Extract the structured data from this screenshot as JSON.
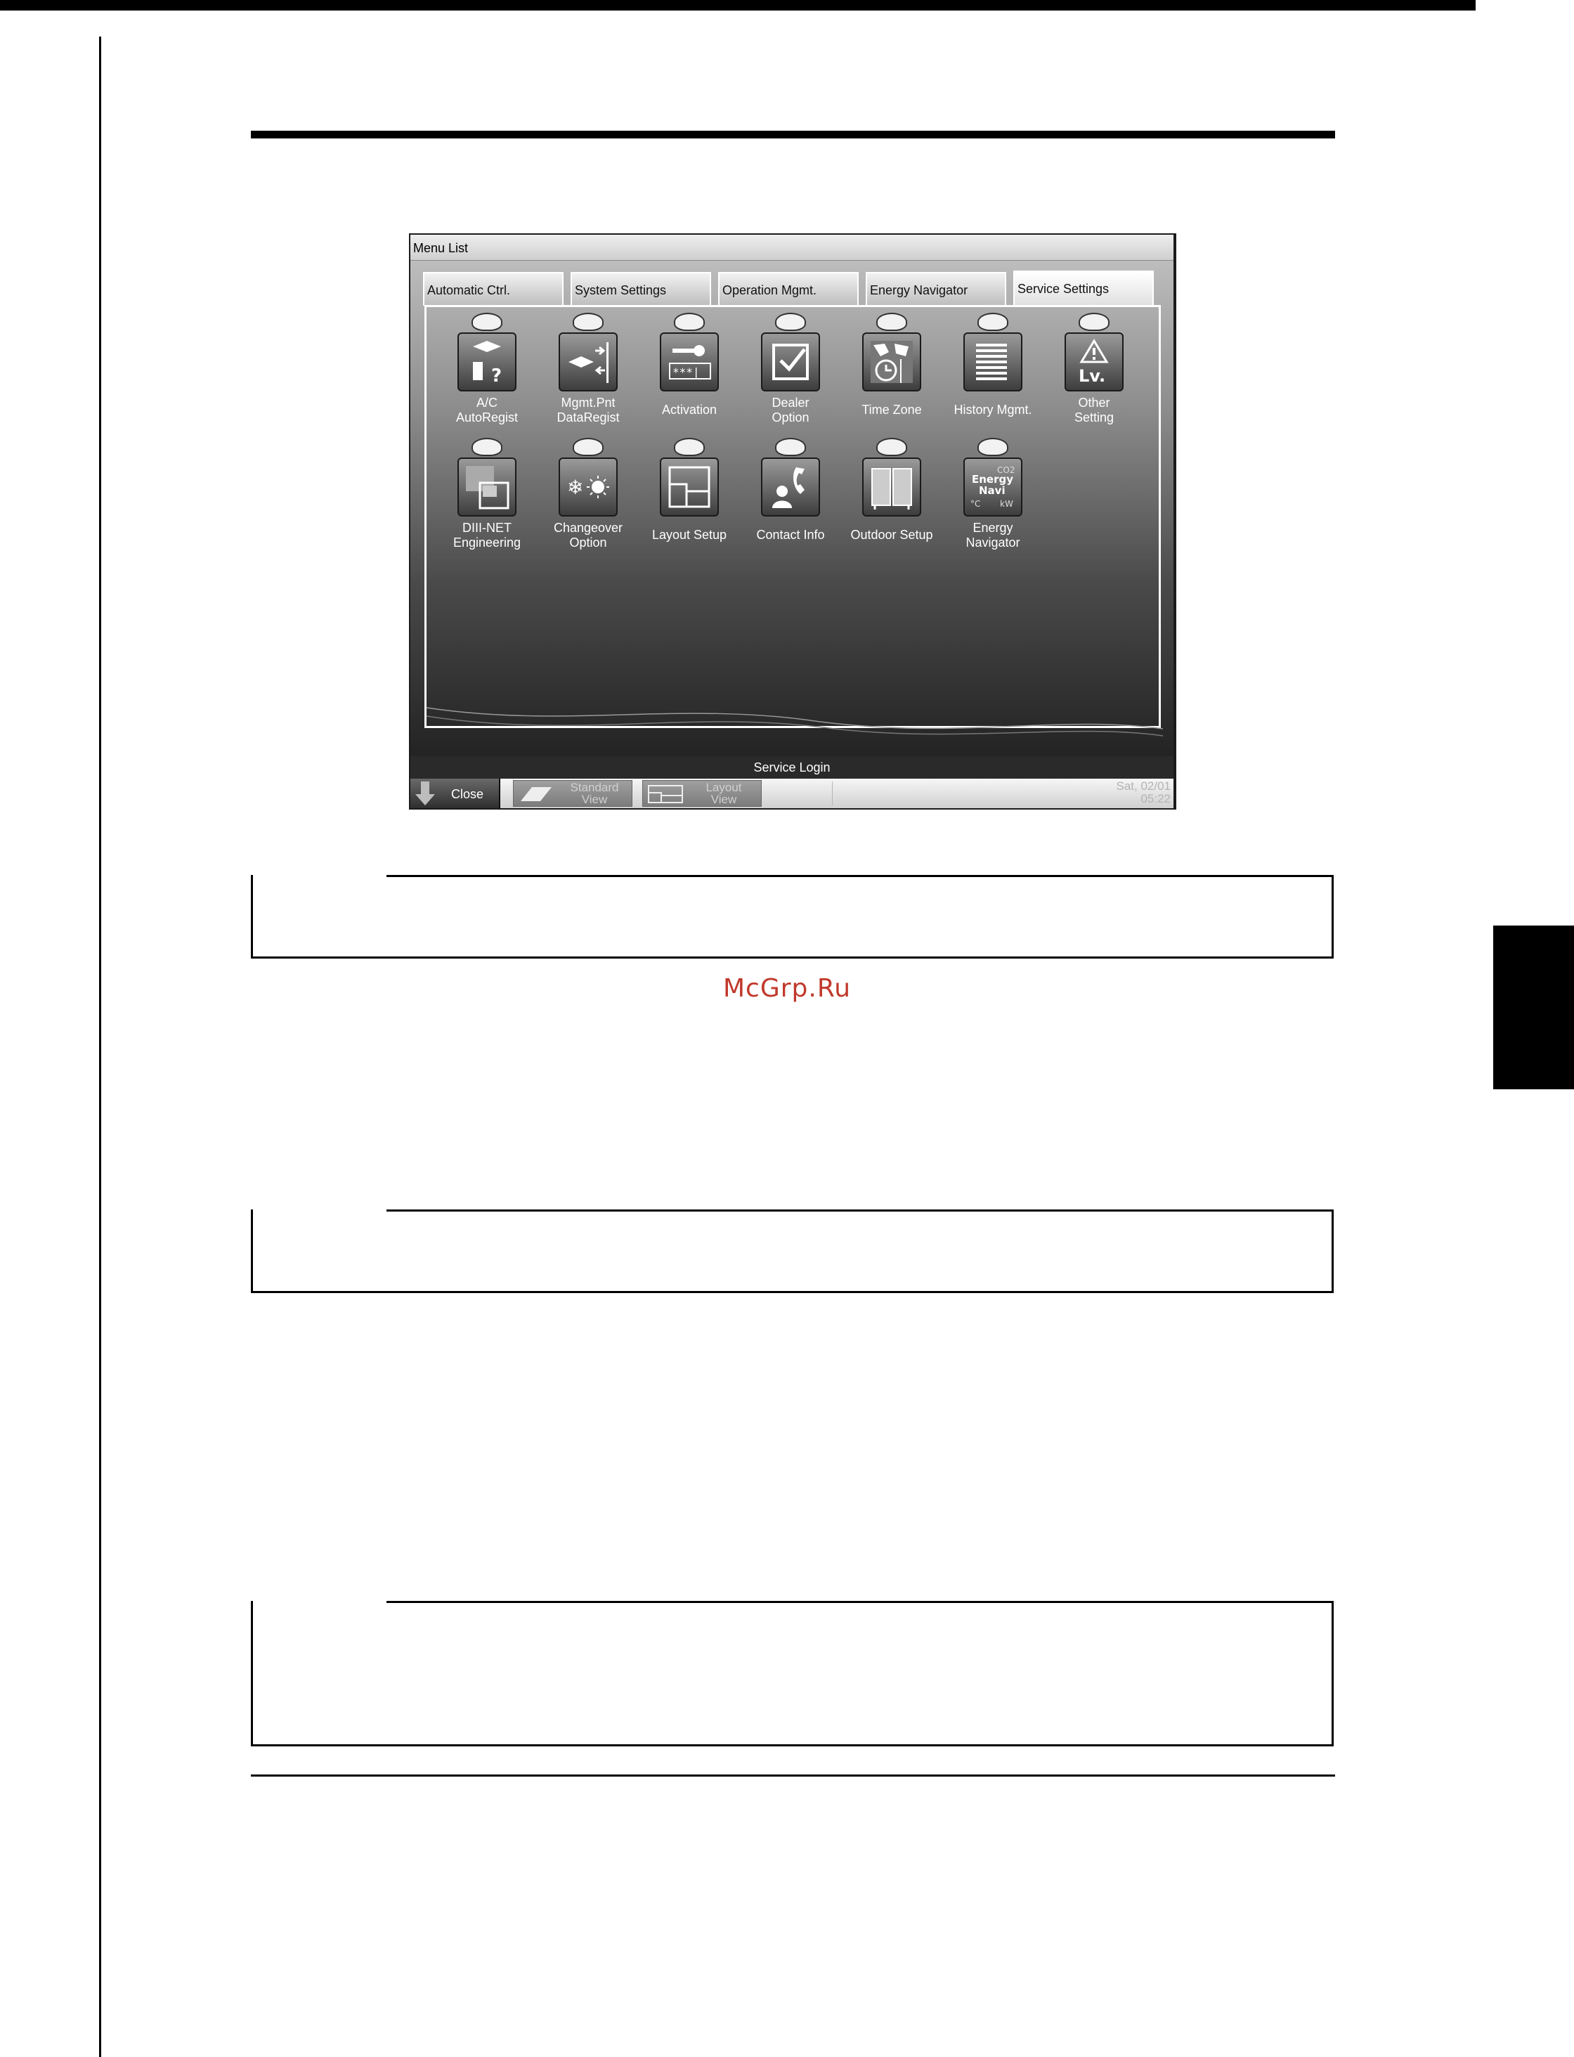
{
  "watermark": "McGrp.Ru",
  "screen": {
    "window_title": "Menu List",
    "tabs": [
      {
        "label": "Automatic Ctrl."
      },
      {
        "label": "System Settings"
      },
      {
        "label": "Operation Mgmt."
      },
      {
        "label": "Energy Navigator"
      },
      {
        "label": "Service Settings",
        "active": true
      }
    ],
    "icons": [
      {
        "label": "A/C\nAutoRegist",
        "icon": "ac-autoregist-icon"
      },
      {
        "label": "Mgmt.Pnt\nDataRegist",
        "icon": "mgmt-pnt-dataregist-icon"
      },
      {
        "label": "Activation",
        "icon": "key-icon"
      },
      {
        "label": "Dealer\nOption",
        "icon": "checkbox-icon"
      },
      {
        "label": "Time Zone",
        "icon": "world-clock-icon"
      },
      {
        "label": "History Mgmt.",
        "icon": "history-icon"
      },
      {
        "label": "Other\nSetting",
        "icon": "warning-level-icon"
      },
      {
        "label": "DIII-NET\nEngineering",
        "icon": "network-engineering-icon"
      },
      {
        "label": "Changeover\nOption",
        "icon": "changeover-icon"
      },
      {
        "label": "Layout Setup",
        "icon": "layout-icon"
      },
      {
        "label": "Contact Info",
        "icon": "phone-contact-icon"
      },
      {
        "label": "Outdoor Setup",
        "icon": "outdoor-unit-icon"
      },
      {
        "label": "Energy\nNavigator",
        "icon": "energy-navi-icon"
      }
    ],
    "energy_icon_text": {
      "co2": "CO2",
      "line1": "Energy",
      "line2": "Navi",
      "unit_c": "°C",
      "unit_kw": "kW"
    },
    "other_icon_text": "Lv.",
    "activation_icon_text": "***|",
    "status": "Service Login",
    "bottom_bar": {
      "close_label": "Close",
      "standard_view_label": "Standard\nView",
      "layout_view_label": "Layout\nView",
      "date": "Sat, 02/01",
      "time": "05:22"
    }
  }
}
